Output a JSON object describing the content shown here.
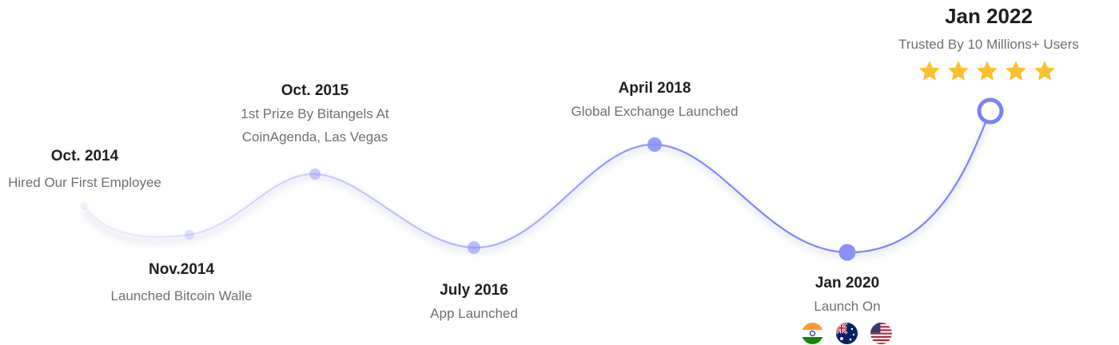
{
  "milestones": [
    {
      "date": "Oct. 2014",
      "desc": [
        "Hired Our First Employee"
      ]
    },
    {
      "date": "Nov.2014",
      "desc": [
        "Launched Bitcoin Walle"
      ]
    },
    {
      "date": "Oct. 2015",
      "desc": [
        "1st Prize By Bitangels At",
        "CoinAgenda, Las Vegas"
      ]
    },
    {
      "date": "July 2016",
      "desc": [
        "App Launched"
      ]
    },
    {
      "date": "April 2018",
      "desc": [
        "Global Exchange Launched"
      ]
    },
    {
      "date": "Jan 2020",
      "desc": [
        "Launch On"
      ]
    },
    {
      "date": "Jan 2022",
      "desc": [
        "Trusted By 10 Millions+ Users"
      ]
    }
  ],
  "rating": {
    "stars": 5,
    "color": "#fbc02d"
  },
  "flags": [
    "india-flag-icon",
    "australia-flag-icon",
    "usa-flag-icon"
  ],
  "colors": {
    "line": "#7b82f5",
    "node": "#8b91f7",
    "final_ring": "#7b82f5"
  }
}
